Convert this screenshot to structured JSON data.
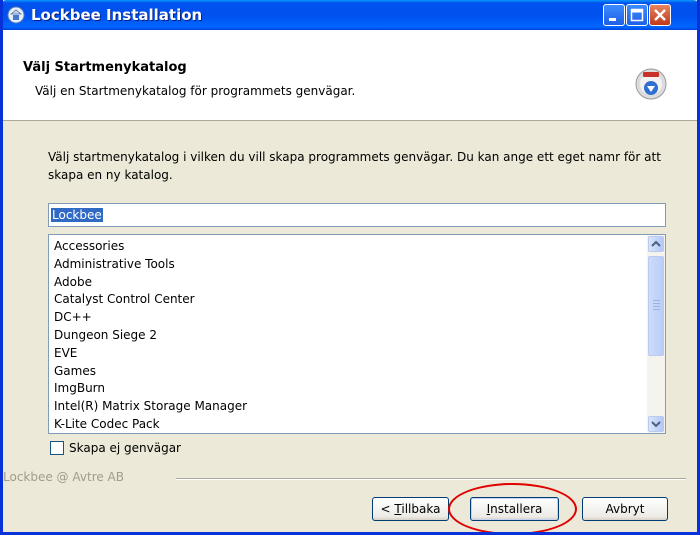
{
  "window": {
    "title": "Lockbee Installation",
    "title_icon": "installer-icon",
    "controls": [
      "minimize-icon",
      "maximize-icon",
      "close-icon"
    ]
  },
  "header": {
    "title": "Välj Startmenykatalog",
    "subtitle": "Välj en Startmenykatalog för programmets genvägar.",
    "icon": "setup-globe-icon"
  },
  "body": {
    "instructions": "Välj startmenykatalog i vilken du vill skapa programmets genvägar. Du kan ange ett eget namr för att skapa en ny katalog.",
    "folder_name": "Lockbee",
    "folders": [
      "Accessories",
      "Administrative Tools",
      "Adobe",
      "Catalyst Control Center",
      "DC++",
      "Dungeon Siege 2",
      "EVE",
      "Games",
      "ImgBurn",
      "Intel(R) Matrix Storage Manager",
      "K-Lite Codec Pack"
    ],
    "no_shortcuts_label": "Skapa ej genvägar",
    "no_shortcuts_checked": false
  },
  "footer": {
    "branding": "Lockbee @ Avtre AB",
    "back_prefix": "< ",
    "back_mnemonic": "T",
    "back_rest": "illbaka",
    "install_mnemonic": "I",
    "install_rest": "nstallera",
    "cancel_label": "Avbryt"
  },
  "colors": {
    "titlebar": "#0053ee",
    "window_bg": "#ece9d8",
    "highlight_ring": "#e00000",
    "selection": "#316ac5"
  }
}
